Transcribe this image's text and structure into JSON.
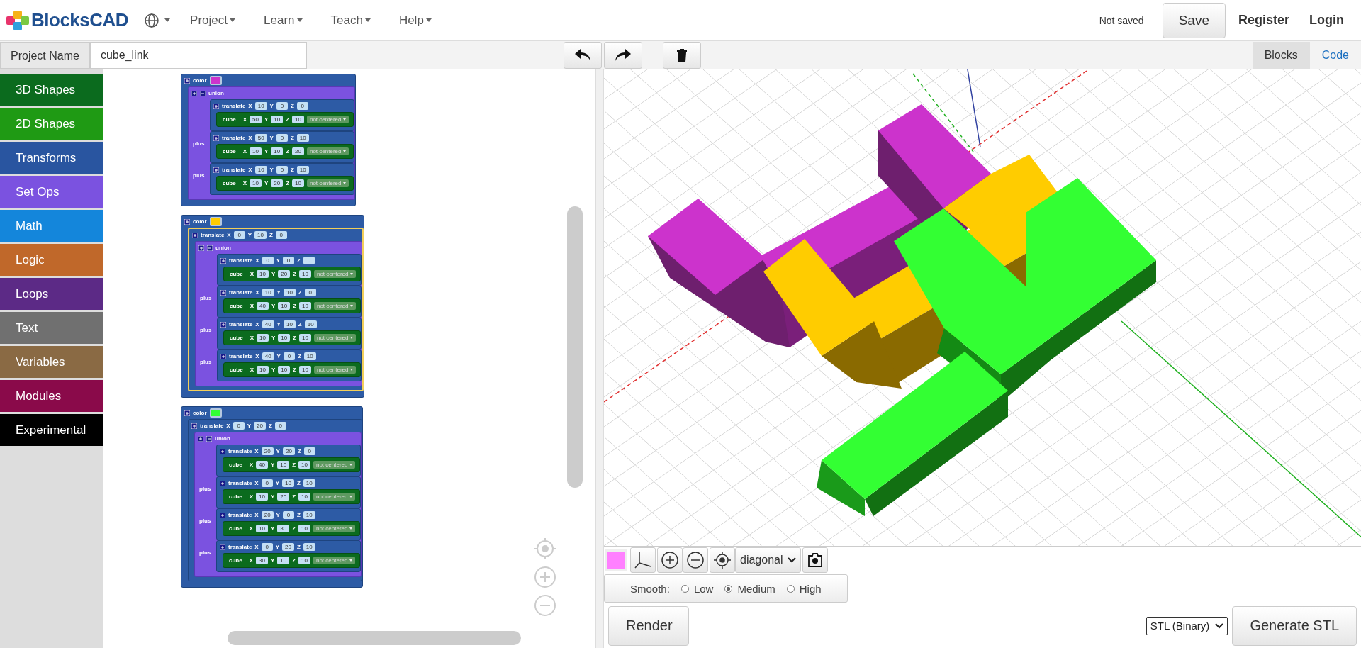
{
  "header": {
    "logo": "BlocksCAD",
    "menus": [
      {
        "label": "Project"
      },
      {
        "label": "Learn"
      },
      {
        "label": "Teach"
      },
      {
        "label": "Help"
      }
    ],
    "save_status": "Not saved",
    "buttons": [
      "Save",
      "Register",
      "Login"
    ]
  },
  "project_bar": {
    "label": "Project Name",
    "value": "cube_link",
    "view_tabs": [
      {
        "label": "Blocks",
        "selected": true
      },
      {
        "label": "Code",
        "selected": false
      }
    ]
  },
  "categories": [
    {
      "label": "3D Shapes",
      "color": "#0b6b1e"
    },
    {
      "label": "2D Shapes",
      "color": "#1f9a14"
    },
    {
      "label": "Transforms",
      "color": "#2955a0"
    },
    {
      "label": "Set Ops",
      "color": "#7b52e0"
    },
    {
      "label": "Math",
      "color": "#1486db"
    },
    {
      "label": "Logic",
      "color": "#c0682a"
    },
    {
      "label": "Loops",
      "color": "#5c2a86"
    },
    {
      "label": "Text",
      "color": "#707070"
    },
    {
      "label": "Variables",
      "color": "#8a6a44"
    },
    {
      "label": "Modules",
      "color": "#8a0a4a"
    },
    {
      "label": "Experimental",
      "color": "#000000"
    }
  ],
  "stacks": [
    {
      "color_block": {
        "label": "color",
        "color": "#cc33cc"
      },
      "union": {
        "label": "union",
        "items": [
          {
            "translate": {
              "label": "translate",
              "fields": [
                {
                  "axis": "X",
                  "value": "10"
                },
                {
                  "axis": "Y",
                  "value": "0"
                },
                {
                  "axis": "Z",
                  "value": "0"
                }
              ]
            },
            "cube": {
              "label": "cube",
              "fields": [
                {
                  "axis": "X",
                  "value": "50"
                },
                {
                  "axis": "Y",
                  "value": "10"
                },
                {
                  "axis": "Z",
                  "value": "10"
                }
              ],
              "centering": "not centered"
            }
          },
          {
            "joiner": "plus",
            "translate": {
              "label": "translate",
              "fields": [
                {
                  "axis": "X",
                  "value": "50"
                },
                {
                  "axis": "Y",
                  "value": "0"
                },
                {
                  "axis": "Z",
                  "value": "10"
                }
              ]
            },
            "cube": {
              "label": "cube",
              "fields": [
                {
                  "axis": "X",
                  "value": "10"
                },
                {
                  "axis": "Y",
                  "value": "10"
                },
                {
                  "axis": "Z",
                  "value": "20"
                }
              ],
              "centering": "not centered"
            }
          },
          {
            "joiner": "plus",
            "translate": {
              "label": "translate",
              "fields": [
                {
                  "axis": "X",
                  "value": "10"
                },
                {
                  "axis": "Y",
                  "value": "0"
                },
                {
                  "axis": "Z",
                  "value": "10"
                }
              ]
            },
            "cube": {
              "label": "cube",
              "fields": [
                {
                  "axis": "X",
                  "value": "10"
                },
                {
                  "axis": "Y",
                  "value": "20"
                },
                {
                  "axis": "Z",
                  "value": "10"
                }
              ],
              "centering": "not centered"
            }
          }
        ]
      }
    },
    {
      "color_block": {
        "label": "color",
        "color": "#ffcc00"
      },
      "translate": {
        "label": "translate",
        "selected": true,
        "fields": [
          {
            "axis": "X",
            "value": "0"
          },
          {
            "axis": "Y",
            "value": "10"
          },
          {
            "axis": "Z",
            "value": "0"
          }
        ]
      },
      "union": {
        "label": "union",
        "items": [
          {
            "translate": {
              "label": "translate",
              "fields": [
                {
                  "axis": "X",
                  "value": "0"
                },
                {
                  "axis": "Y",
                  "value": "0"
                },
                {
                  "axis": "Z",
                  "value": "0"
                }
              ]
            },
            "cube": {
              "label": "cube",
              "fields": [
                {
                  "axis": "X",
                  "value": "10"
                },
                {
                  "axis": "Y",
                  "value": "20"
                },
                {
                  "axis": "Z",
                  "value": "10"
                }
              ],
              "centering": "not centered"
            }
          },
          {
            "joiner": "plus",
            "translate": {
              "label": "translate",
              "fields": [
                {
                  "axis": "X",
                  "value": "10"
                },
                {
                  "axis": "Y",
                  "value": "10"
                },
                {
                  "axis": "Z",
                  "value": "0"
                }
              ]
            },
            "cube": {
              "label": "cube",
              "fields": [
                {
                  "axis": "X",
                  "value": "40"
                },
                {
                  "axis": "Y",
                  "value": "10"
                },
                {
                  "axis": "Z",
                  "value": "10"
                }
              ],
              "centering": "not centered"
            }
          },
          {
            "joiner": "plus",
            "translate": {
              "label": "translate",
              "fields": [
                {
                  "axis": "X",
                  "value": "40"
                },
                {
                  "axis": "Y",
                  "value": "10"
                },
                {
                  "axis": "Z",
                  "value": "10"
                }
              ]
            },
            "cube": {
              "label": "cube",
              "fields": [
                {
                  "axis": "X",
                  "value": "10"
                },
                {
                  "axis": "Y",
                  "value": "10"
                },
                {
                  "axis": "Z",
                  "value": "10"
                }
              ],
              "centering": "not centered"
            }
          },
          {
            "joiner": "plus",
            "translate": {
              "label": "translate",
              "fields": [
                {
                  "axis": "X",
                  "value": "40"
                },
                {
                  "axis": "Y",
                  "value": "0"
                },
                {
                  "axis": "Z",
                  "value": "10"
                }
              ]
            },
            "cube": {
              "label": "cube",
              "fields": [
                {
                  "axis": "X",
                  "value": "10"
                },
                {
                  "axis": "Y",
                  "value": "10"
                },
                {
                  "axis": "Z",
                  "value": "10"
                }
              ],
              "centering": "not centered"
            }
          }
        ]
      }
    },
    {
      "color_block": {
        "label": "color",
        "color": "#33ff33"
      },
      "translate": {
        "label": "translate",
        "selected": false,
        "fields": [
          {
            "axis": "X",
            "value": "0"
          },
          {
            "axis": "Y",
            "value": "20"
          },
          {
            "axis": "Z",
            "value": "0"
          }
        ]
      },
      "union": {
        "label": "union",
        "items": [
          {
            "translate": {
              "label": "translate",
              "fields": [
                {
                  "axis": "X",
                  "value": "20"
                },
                {
                  "axis": "Y",
                  "value": "20"
                },
                {
                  "axis": "Z",
                  "value": "0"
                }
              ]
            },
            "cube": {
              "label": "cube",
              "fields": [
                {
                  "axis": "X",
                  "value": "40"
                },
                {
                  "axis": "Y",
                  "value": "10"
                },
                {
                  "axis": "Z",
                  "value": "10"
                }
              ],
              "centering": "not centered"
            }
          },
          {
            "joiner": "plus",
            "translate": {
              "label": "translate",
              "fields": [
                {
                  "axis": "X",
                  "value": "0"
                },
                {
                  "axis": "Y",
                  "value": "10"
                },
                {
                  "axis": "Z",
                  "value": "10"
                }
              ]
            },
            "cube": {
              "label": "cube",
              "fields": [
                {
                  "axis": "X",
                  "value": "10"
                },
                {
                  "axis": "Y",
                  "value": "20"
                },
                {
                  "axis": "Z",
                  "value": "10"
                }
              ],
              "centering": "not centered"
            }
          },
          {
            "joiner": "plus",
            "translate": {
              "label": "translate",
              "fields": [
                {
                  "axis": "X",
                  "value": "20"
                },
                {
                  "axis": "Y",
                  "value": "0"
                },
                {
                  "axis": "Z",
                  "value": "10"
                }
              ]
            },
            "cube": {
              "label": "cube",
              "fields": [
                {
                  "axis": "X",
                  "value": "10"
                },
                {
                  "axis": "Y",
                  "value": "30"
                },
                {
                  "axis": "Z",
                  "value": "10"
                }
              ],
              "centering": "not centered"
            }
          },
          {
            "joiner": "plus",
            "translate": {
              "label": "translate",
              "fields": [
                {
                  "axis": "X",
                  "value": "0"
                },
                {
                  "axis": "Y",
                  "value": "20"
                },
                {
                  "axis": "Z",
                  "value": "10"
                }
              ]
            },
            "cube": {
              "label": "cube",
              "fields": [
                {
                  "axis": "X",
                  "value": "30"
                },
                {
                  "axis": "Y",
                  "value": "10"
                },
                {
                  "axis": "Z",
                  "value": "10"
                }
              ],
              "centering": "not centered"
            }
          }
        ]
      }
    }
  ],
  "viewer": {
    "view": "diagonal",
    "smooth": {
      "label": "Smooth:",
      "options": [
        {
          "label": "Low",
          "selected": false
        },
        {
          "label": "Medium",
          "selected": true
        },
        {
          "label": "High",
          "selected": false
        }
      ]
    },
    "render": "Render",
    "format": "STL (Binary)",
    "generate": "Generate STL"
  }
}
